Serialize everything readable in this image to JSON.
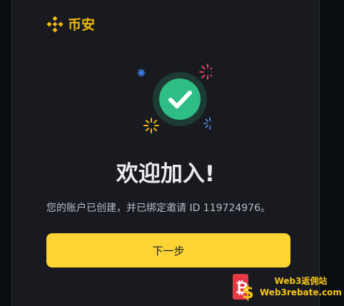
{
  "brand": {
    "name": "币安",
    "logo_icon": "binance-diamond-icon",
    "color": "#f0b90b"
  },
  "hero": {
    "icon": "success-check-icon",
    "circle_color": "#2ebd85",
    "ring_color": "#1d3a33",
    "sparkle_colors": [
      "#3b82f6",
      "#f6465d",
      "#f0b90b",
      "#5b8ce6"
    ]
  },
  "title": "欢迎加入!",
  "subtitle": "您的账户已创建，并已绑定邀请 ID 119724976。",
  "next_button": {
    "label": "下一步",
    "color": "#fcd535"
  },
  "watermark": {
    "line1": "Web3返佣站",
    "line2": "Web3rebate.com",
    "icon": "dollar-bitcoin-icon",
    "colors": [
      "#e63946",
      "#f5c518"
    ]
  }
}
